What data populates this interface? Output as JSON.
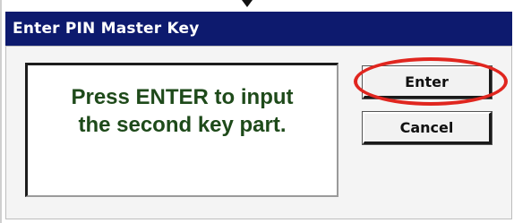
{
  "dialog": {
    "title": "Enter PIN Master Key",
    "message": "Press ENTER to input\nthe second key part.",
    "enter_label": "Enter",
    "cancel_label": "Cancel"
  },
  "colors": {
    "title_bar": "#0d1a6e",
    "message_text": "#1e4a1a",
    "highlight": "#e0261f"
  }
}
